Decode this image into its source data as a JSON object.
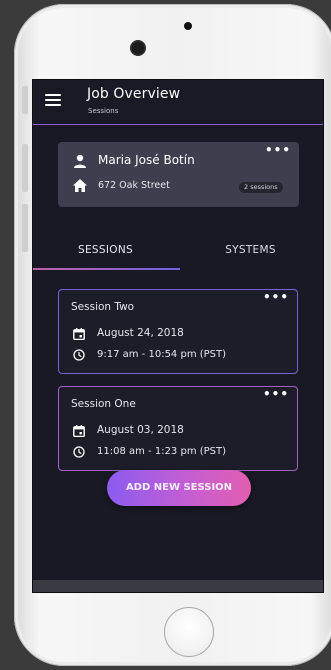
{
  "app": {
    "title": "Job Overview",
    "subtitle": "Sessions"
  },
  "client": {
    "name": "Maria José Botín",
    "address": "672 Oak Street",
    "sessions_badge": "2 sessions",
    "more_icon": "more-horizontal-icon"
  },
  "tabs": [
    {
      "label": "SESSIONS",
      "selected": true
    },
    {
      "label": "SYSTEMS",
      "selected": false
    }
  ],
  "sessions": [
    {
      "title": "Session Two",
      "date": "August 24, 2018",
      "time": "9:17 am - 10:54 pm (PST)"
    },
    {
      "title": "Session One",
      "date": "August 03, 2018",
      "time": "11:08 am - 1:23 pm (PST)"
    }
  ],
  "actions": {
    "add_session_label": "ADD NEW SESSION"
  },
  "icons": {
    "menu": "menu-icon",
    "person": "person-icon",
    "home": "home-icon",
    "calendar": "calendar-icon",
    "clock": "clock-icon"
  },
  "colors": {
    "background": "#191925",
    "card": "#3e3e4e",
    "accent_start": "#8a5cf0",
    "accent_end": "#e25eb0"
  }
}
